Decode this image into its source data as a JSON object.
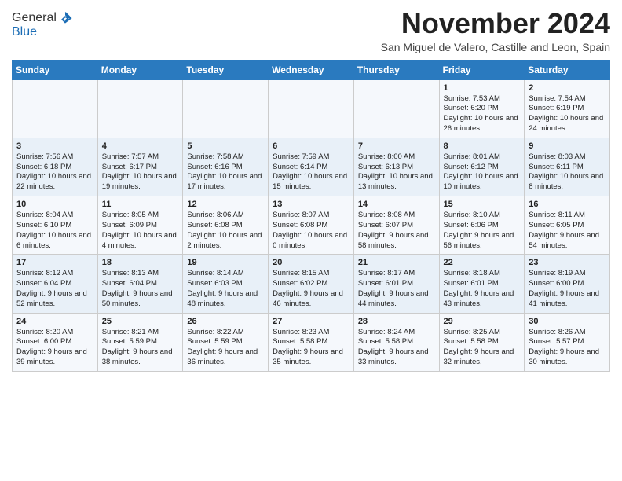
{
  "header": {
    "logo_general": "General",
    "logo_blue": "Blue",
    "month": "November 2024",
    "location": "San Miguel de Valero, Castille and Leon, Spain"
  },
  "days_of_week": [
    "Sunday",
    "Monday",
    "Tuesday",
    "Wednesday",
    "Thursday",
    "Friday",
    "Saturday"
  ],
  "weeks": [
    [
      {
        "day": "",
        "info": ""
      },
      {
        "day": "",
        "info": ""
      },
      {
        "day": "",
        "info": ""
      },
      {
        "day": "",
        "info": ""
      },
      {
        "day": "",
        "info": ""
      },
      {
        "day": "1",
        "info": "Sunrise: 7:53 AM\nSunset: 6:20 PM\nDaylight: 10 hours and 26 minutes."
      },
      {
        "day": "2",
        "info": "Sunrise: 7:54 AM\nSunset: 6:19 PM\nDaylight: 10 hours and 24 minutes."
      }
    ],
    [
      {
        "day": "3",
        "info": "Sunrise: 7:56 AM\nSunset: 6:18 PM\nDaylight: 10 hours and 22 minutes."
      },
      {
        "day": "4",
        "info": "Sunrise: 7:57 AM\nSunset: 6:17 PM\nDaylight: 10 hours and 19 minutes."
      },
      {
        "day": "5",
        "info": "Sunrise: 7:58 AM\nSunset: 6:16 PM\nDaylight: 10 hours and 17 minutes."
      },
      {
        "day": "6",
        "info": "Sunrise: 7:59 AM\nSunset: 6:14 PM\nDaylight: 10 hours and 15 minutes."
      },
      {
        "day": "7",
        "info": "Sunrise: 8:00 AM\nSunset: 6:13 PM\nDaylight: 10 hours and 13 minutes."
      },
      {
        "day": "8",
        "info": "Sunrise: 8:01 AM\nSunset: 6:12 PM\nDaylight: 10 hours and 10 minutes."
      },
      {
        "day": "9",
        "info": "Sunrise: 8:03 AM\nSunset: 6:11 PM\nDaylight: 10 hours and 8 minutes."
      }
    ],
    [
      {
        "day": "10",
        "info": "Sunrise: 8:04 AM\nSunset: 6:10 PM\nDaylight: 10 hours and 6 minutes."
      },
      {
        "day": "11",
        "info": "Sunrise: 8:05 AM\nSunset: 6:09 PM\nDaylight: 10 hours and 4 minutes."
      },
      {
        "day": "12",
        "info": "Sunrise: 8:06 AM\nSunset: 6:08 PM\nDaylight: 10 hours and 2 minutes."
      },
      {
        "day": "13",
        "info": "Sunrise: 8:07 AM\nSunset: 6:08 PM\nDaylight: 10 hours and 0 minutes."
      },
      {
        "day": "14",
        "info": "Sunrise: 8:08 AM\nSunset: 6:07 PM\nDaylight: 9 hours and 58 minutes."
      },
      {
        "day": "15",
        "info": "Sunrise: 8:10 AM\nSunset: 6:06 PM\nDaylight: 9 hours and 56 minutes."
      },
      {
        "day": "16",
        "info": "Sunrise: 8:11 AM\nSunset: 6:05 PM\nDaylight: 9 hours and 54 minutes."
      }
    ],
    [
      {
        "day": "17",
        "info": "Sunrise: 8:12 AM\nSunset: 6:04 PM\nDaylight: 9 hours and 52 minutes."
      },
      {
        "day": "18",
        "info": "Sunrise: 8:13 AM\nSunset: 6:04 PM\nDaylight: 9 hours and 50 minutes."
      },
      {
        "day": "19",
        "info": "Sunrise: 8:14 AM\nSunset: 6:03 PM\nDaylight: 9 hours and 48 minutes."
      },
      {
        "day": "20",
        "info": "Sunrise: 8:15 AM\nSunset: 6:02 PM\nDaylight: 9 hours and 46 minutes."
      },
      {
        "day": "21",
        "info": "Sunrise: 8:17 AM\nSunset: 6:01 PM\nDaylight: 9 hours and 44 minutes."
      },
      {
        "day": "22",
        "info": "Sunrise: 8:18 AM\nSunset: 6:01 PM\nDaylight: 9 hours and 43 minutes."
      },
      {
        "day": "23",
        "info": "Sunrise: 8:19 AM\nSunset: 6:00 PM\nDaylight: 9 hours and 41 minutes."
      }
    ],
    [
      {
        "day": "24",
        "info": "Sunrise: 8:20 AM\nSunset: 6:00 PM\nDaylight: 9 hours and 39 minutes."
      },
      {
        "day": "25",
        "info": "Sunrise: 8:21 AM\nSunset: 5:59 PM\nDaylight: 9 hours and 38 minutes."
      },
      {
        "day": "26",
        "info": "Sunrise: 8:22 AM\nSunset: 5:59 PM\nDaylight: 9 hours and 36 minutes."
      },
      {
        "day": "27",
        "info": "Sunrise: 8:23 AM\nSunset: 5:58 PM\nDaylight: 9 hours and 35 minutes."
      },
      {
        "day": "28",
        "info": "Sunrise: 8:24 AM\nSunset: 5:58 PM\nDaylight: 9 hours and 33 minutes."
      },
      {
        "day": "29",
        "info": "Sunrise: 8:25 AM\nSunset: 5:58 PM\nDaylight: 9 hours and 32 minutes."
      },
      {
        "day": "30",
        "info": "Sunrise: 8:26 AM\nSunset: 5:57 PM\nDaylight: 9 hours and 30 minutes."
      }
    ]
  ]
}
